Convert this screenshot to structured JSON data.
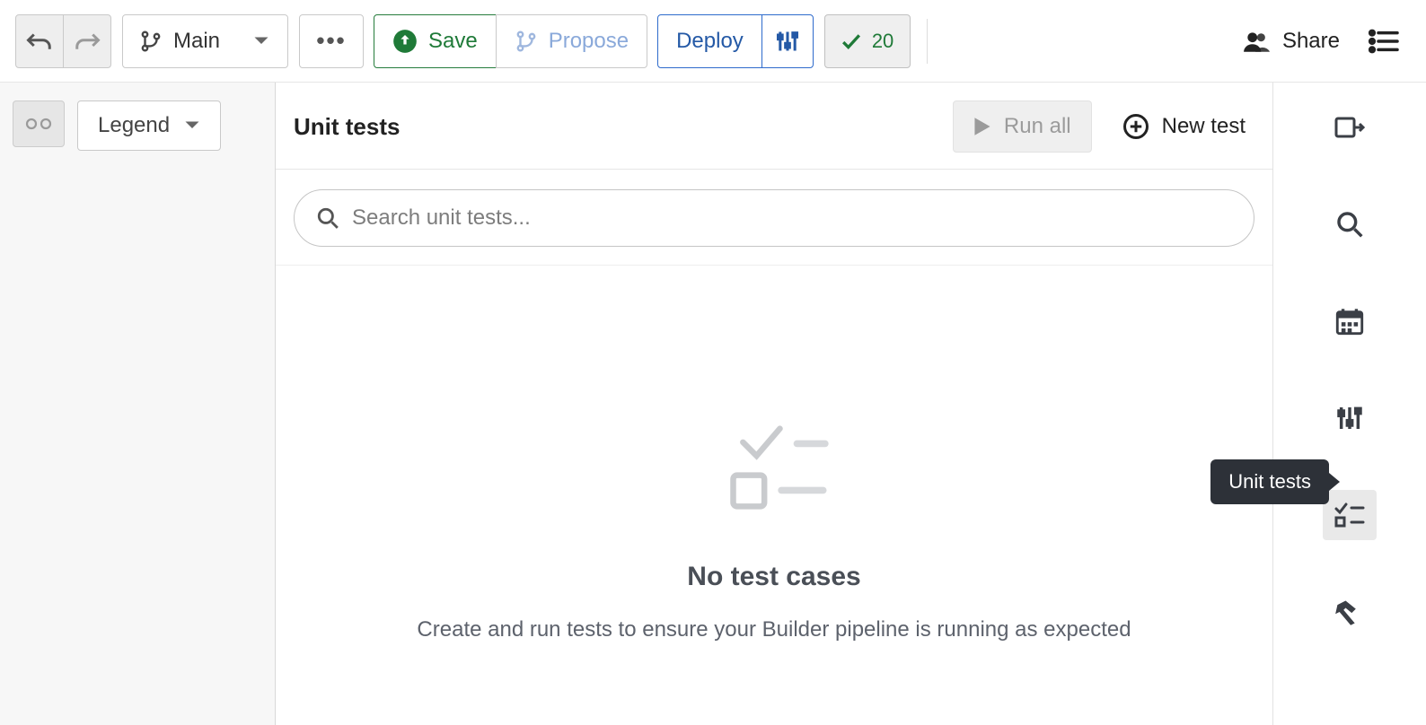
{
  "toolbar": {
    "branch_label": "Main",
    "save_label": "Save",
    "propose_label": "Propose",
    "deploy_label": "Deploy",
    "checks_count": "20",
    "share_label": "Share"
  },
  "left_panel": {
    "legend_label": "Legend"
  },
  "unit_tests": {
    "title": "Unit tests",
    "run_all_label": "Run all",
    "new_test_label": "New test",
    "search_placeholder": "Search unit tests...",
    "empty_title": "No test cases",
    "empty_subtitle": "Create and run tests to ensure your Builder pipeline is running as expected"
  },
  "tooltip": {
    "unit_tests": "Unit tests"
  }
}
